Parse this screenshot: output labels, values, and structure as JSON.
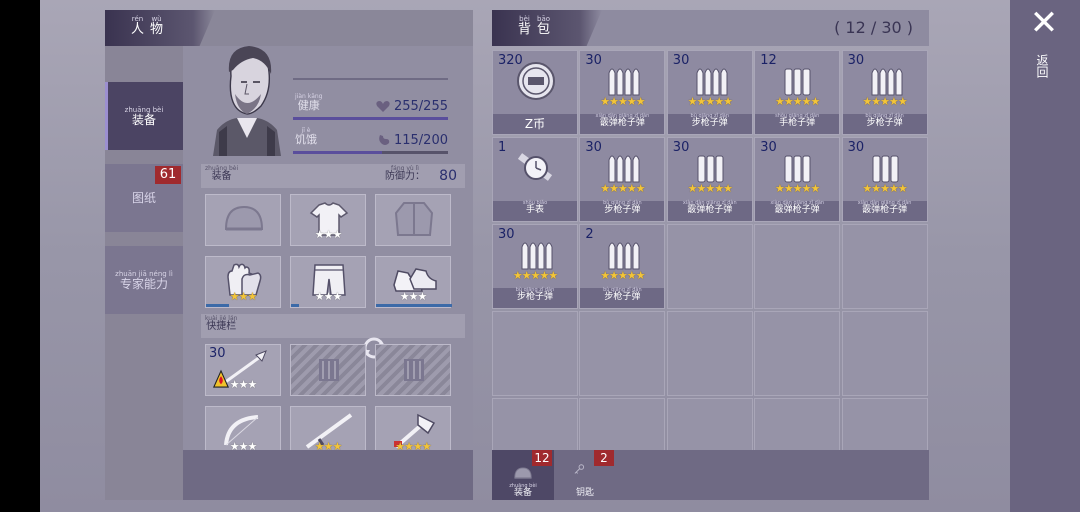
{
  "character_panel": {
    "header": {
      "words": [
        {
          "py": "rén",
          "hz": "人"
        },
        {
          "py": "wù",
          "hz": "物"
        }
      ]
    },
    "tabs": [
      {
        "label": "装备",
        "py": "zhuāng bèi",
        "active": true
      },
      {
        "label": "图纸",
        "py": "",
        "badge": "61"
      },
      {
        "label": "专家能力",
        "py": "zhuān jiā néng lì"
      }
    ],
    "stats": [
      {
        "label": "健康",
        "py": "jiàn kāng",
        "icon": "heart-icon",
        "value": "255/255",
        "ratio": 1.0
      },
      {
        "label": "饥饿",
        "py": "jī è",
        "icon": "stomach-icon",
        "value": "115/200",
        "ratio": 0.575
      }
    ],
    "equipment_section": {
      "label": "装备",
      "py": "zhuāng bèi",
      "defense_label": "防御力：",
      "defense_py": "fáng yù lì",
      "defense_value": "80"
    },
    "quick_section": {
      "label": "快捷栏",
      "py": "kuài jié lán"
    },
    "equip_slots": [
      {
        "icon": "helmet-icon",
        "stars": 0,
        "empty": true
      },
      {
        "icon": "tshirt-icon",
        "stars": 3,
        "gold": 0
      },
      {
        "icon": "jacket-icon",
        "stars": 0,
        "empty": true
      },
      {
        "icon": "gloves-icon",
        "stars": 3,
        "gold": 3,
        "durability": 0.3
      },
      {
        "icon": "shorts-icon",
        "stars": 3,
        "gold": 0,
        "durability": 0.1
      },
      {
        "icon": "sneakers-icon",
        "stars": 3,
        "gold": 0,
        "durability": 1.0
      }
    ],
    "quick_slots": [
      {
        "icon": "spear-icon",
        "count": "30",
        "stars": 3,
        "gold": 0,
        "fire": true
      },
      {
        "icon": "locked-slot-icon",
        "locked": true
      },
      {
        "icon": "locked-slot-icon",
        "locked": true
      },
      {
        "icon": "bow-icon",
        "stars": 3,
        "gold": 0,
        "durability": 1.0
      },
      {
        "icon": "rifle-icon",
        "stars": 3,
        "gold": 3,
        "durability": 0.9
      },
      {
        "icon": "axe-icon",
        "stars": 4,
        "gold": 4,
        "durability": 0.05,
        "red": true
      }
    ]
  },
  "bag_panel": {
    "header": {
      "words": [
        {
          "py": "bèi",
          "hz": "背"
        },
        {
          "py": "bāo",
          "hz": "包"
        }
      ]
    },
    "capacity": "( 12 / 30 )",
    "items": [
      {
        "count": "320",
        "icon": "coin-icon",
        "name": "Z币",
        "py": "",
        "stars": 0
      },
      {
        "count": "30",
        "icon": "bullets-icon",
        "name": "霰弹枪子弹",
        "py": "xiàn dàn qiāng zǐ dàn",
        "stars": 5
      },
      {
        "count": "30",
        "icon": "bullets-icon",
        "name": "步枪子弹",
        "py": "bù qiāng zǐ dàn",
        "stars": 5
      },
      {
        "count": "12",
        "icon": "shells-icon",
        "name": "手枪子弹",
        "py": "shǒu qiāng zǐ dàn",
        "stars": 5
      },
      {
        "count": "30",
        "icon": "bullets-icon",
        "name": "步枪子弹",
        "py": "bù qiāng zǐ dàn",
        "stars": 5
      },
      {
        "count": "1",
        "icon": "watch-icon",
        "name": "手表",
        "py": "shǒu biǎo",
        "stars": 0
      },
      {
        "count": "30",
        "icon": "bullets-icon",
        "name": "步枪子弹",
        "py": "bù qiāng zǐ dàn",
        "stars": 5
      },
      {
        "count": "30",
        "icon": "shells-icon",
        "name": "霰弹枪子弹",
        "py": "xiàn dàn qiāng zǐ dàn",
        "stars": 5
      },
      {
        "count": "30",
        "icon": "shells-icon",
        "name": "霰弹枪子弹",
        "py": "xiàn dàn qiāng zǐ dàn",
        "stars": 5
      },
      {
        "count": "30",
        "icon": "shells-icon",
        "name": "霰弹枪子弹",
        "py": "xiàn dàn qiāng zǐ dàn",
        "stars": 5
      },
      {
        "count": "30",
        "icon": "bullets-icon",
        "name": "步枪子弹",
        "py": "bù qiāng zǐ dàn",
        "stars": 5
      },
      {
        "count": "2",
        "icon": "bullets-icon",
        "name": "步枪子弹",
        "py": "bù qiāng zǐ dàn",
        "stars": 5
      }
    ],
    "empty_slots": 13,
    "bottom_tabs": [
      {
        "label": "装备",
        "py": "zhuāng bèi",
        "icon": "helmet-icon",
        "badge": "12",
        "active": true
      },
      {
        "label": "钥匙",
        "py": "",
        "icon": "key-icon",
        "badge": "2",
        "active": false
      }
    ]
  },
  "close_label": "✕",
  "return_label": "返回",
  "colors": {
    "star_gold": "#f3c53a",
    "badge_red": "#a02a2e",
    "value_blue": "#2a2f6e"
  }
}
